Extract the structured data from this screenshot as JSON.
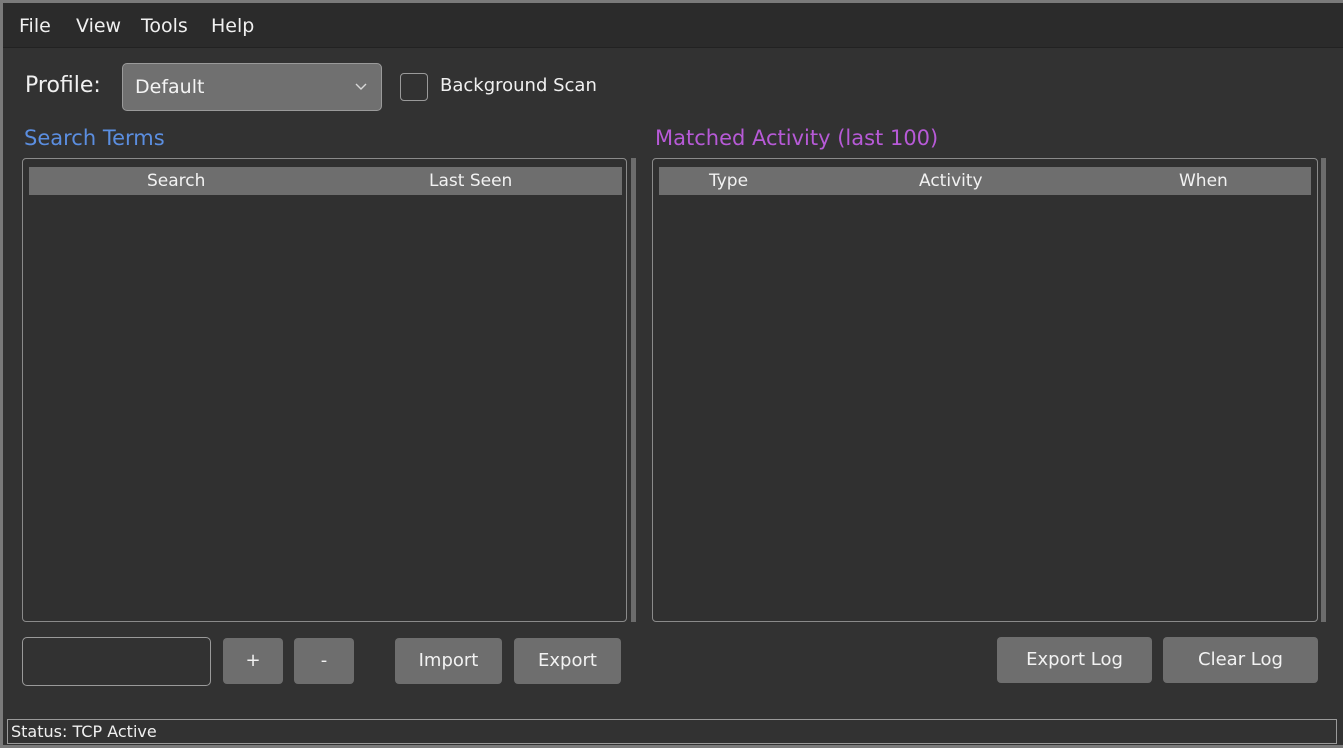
{
  "menubar": {
    "items": [
      "File",
      "View",
      "Tools",
      "Help"
    ]
  },
  "profile": {
    "label": "Profile:",
    "selected": "Default"
  },
  "background_scan": {
    "label": "Background Scan",
    "checked": false
  },
  "search_terms": {
    "title": "Search Terms",
    "columns": [
      "Search",
      "Last Seen"
    ],
    "rows": []
  },
  "matched_activity": {
    "title": "Matched Activity (last 100)",
    "columns": [
      "Type",
      "Activity",
      "When"
    ],
    "rows": []
  },
  "term_input": {
    "value": ""
  },
  "buttons": {
    "add": "+",
    "remove": "-",
    "import": "Import",
    "export": "Export",
    "export_log": "Export Log",
    "clear_log": "Clear Log"
  },
  "status": {
    "text": "Status: TCP Active"
  },
  "colors": {
    "search_terms_title": "#5b8ee0",
    "matched_activity_title": "#b75ad7"
  }
}
